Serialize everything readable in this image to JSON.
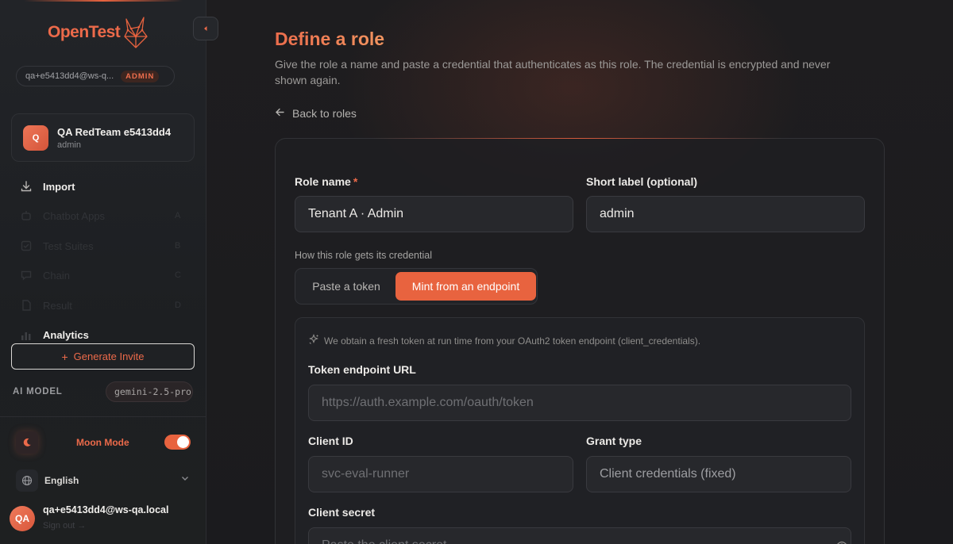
{
  "brand": {
    "name": "OpenTest",
    "accent": "#ec6a4a"
  },
  "account": {
    "email_truncated": "qa+e5413dd4@ws-q...",
    "role_badge": "ADMIN"
  },
  "workspace": {
    "avatar_letter": "Q",
    "name": "QA RedTeam e5413dd4",
    "role": "admin"
  },
  "nav": {
    "import_label": "Import",
    "faded_items": [
      {
        "label": "Chatbot Apps",
        "trail": "A"
      },
      {
        "label": "Test Suites",
        "trail": "B"
      },
      {
        "label": "Chain",
        "trail": "C"
      },
      {
        "label": "Result",
        "trail": "D"
      }
    ],
    "analytics_label": "Analytics"
  },
  "invite": {
    "label": "Generate Invite"
  },
  "ai_model": {
    "label": "AI MODEL",
    "value": "gemini-2.5-pro"
  },
  "moon_mode": {
    "label": "Moon Mode",
    "enabled": true
  },
  "language": {
    "label": "English"
  },
  "user": {
    "initials": "QA",
    "email": "qa+e5413dd4@ws-qa.local",
    "sign_out": "Sign out →"
  },
  "page": {
    "title": "Define a role",
    "description": "Give the role a name and paste a credential that authenticates as this role. The credential is encrypted and never shown again.",
    "back_label": "Back to roles"
  },
  "form": {
    "role_name": {
      "label": "Role name",
      "required_mark": "*",
      "value": "Tenant A · Admin"
    },
    "short_label": {
      "label": "Short label (optional)",
      "value": "admin"
    },
    "credential_mode": {
      "caption": "How this role gets its credential",
      "options": [
        "Paste a token",
        "Mint from an endpoint"
      ],
      "selected": "Mint from an endpoint"
    },
    "endpoint": {
      "hint": "We obtain a fresh token at run time from your OAuth2 token endpoint (client_credentials).",
      "token_url": {
        "label": "Token endpoint URL",
        "placeholder": "https://auth.example.com/oauth/token"
      },
      "client_id": {
        "label": "Client ID",
        "placeholder": "svc-eval-runner"
      },
      "grant_type": {
        "label": "Grant type",
        "value": "Client credentials (fixed)"
      },
      "client_secret": {
        "label": "Client secret",
        "placeholder": "Paste the client secret"
      }
    }
  }
}
